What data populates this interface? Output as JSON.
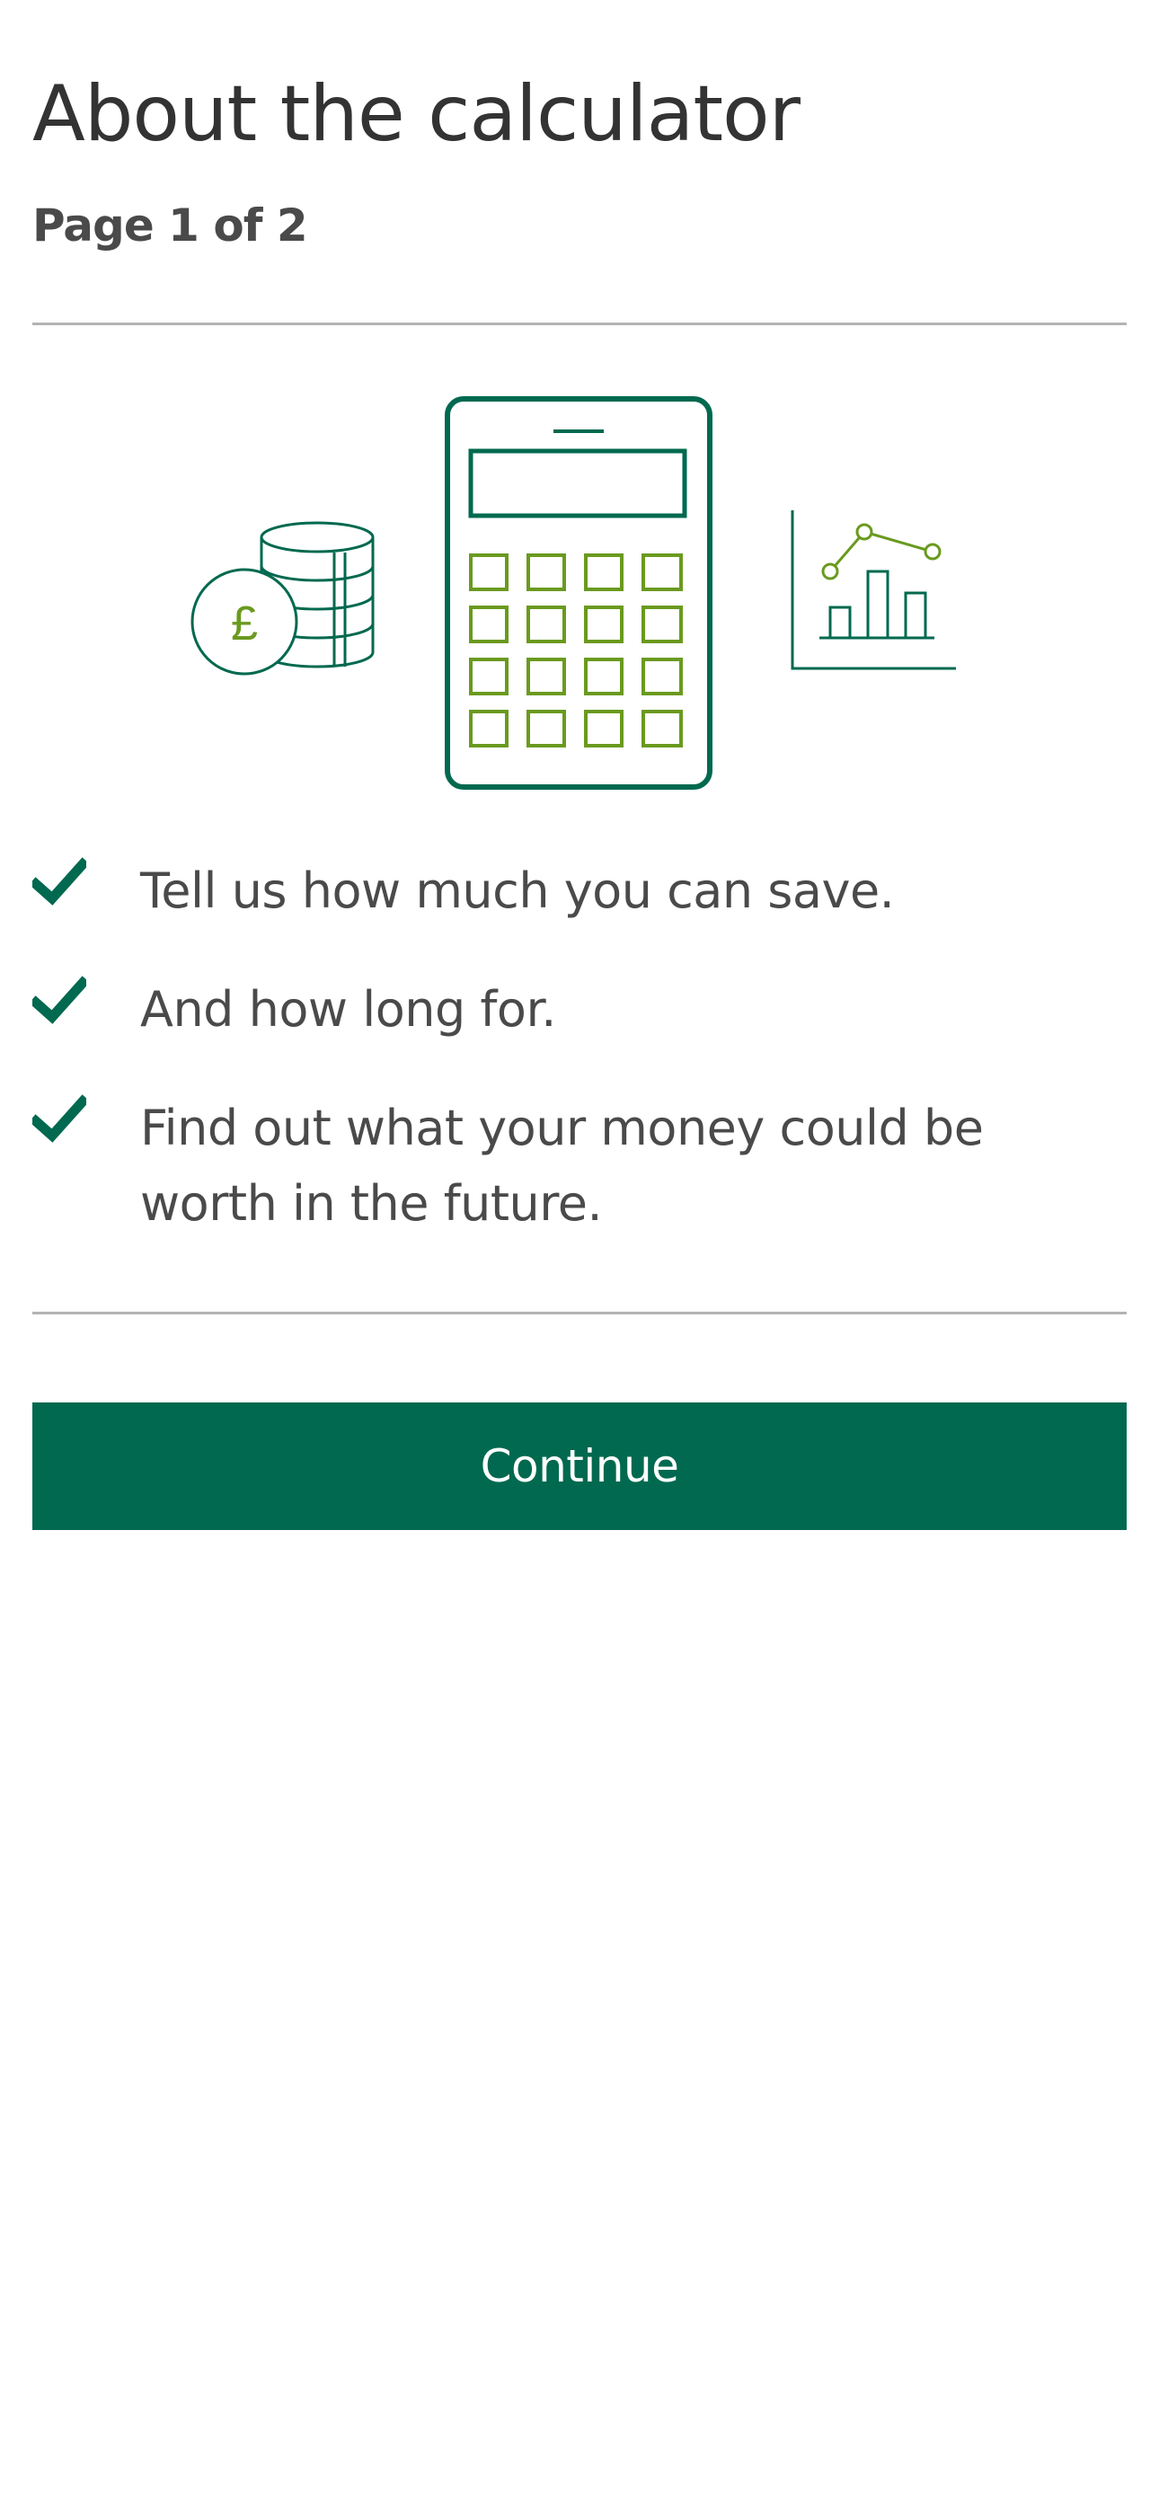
{
  "header": {
    "title": "About the calculator",
    "page_indicator": "Page 1 of 2"
  },
  "illustration": {
    "coins_icon": "coin-stack-pound-icon",
    "calculator_icon": "calculator-icon",
    "chart_icon": "bar-line-chart-icon",
    "currency_symbol": "£"
  },
  "checklist": {
    "icon": "check-icon",
    "items": [
      {
        "text": "Tell us how much you can save."
      },
      {
        "text": "And how long for."
      },
      {
        "text": "Find out what your money could be worth in the future."
      }
    ]
  },
  "actions": {
    "continue_label": "Continue"
  },
  "colors": {
    "brand_green": "#00694f",
    "accent_green": "#6a9a1f",
    "text": "#333333",
    "divider": "#b3b3b3"
  }
}
